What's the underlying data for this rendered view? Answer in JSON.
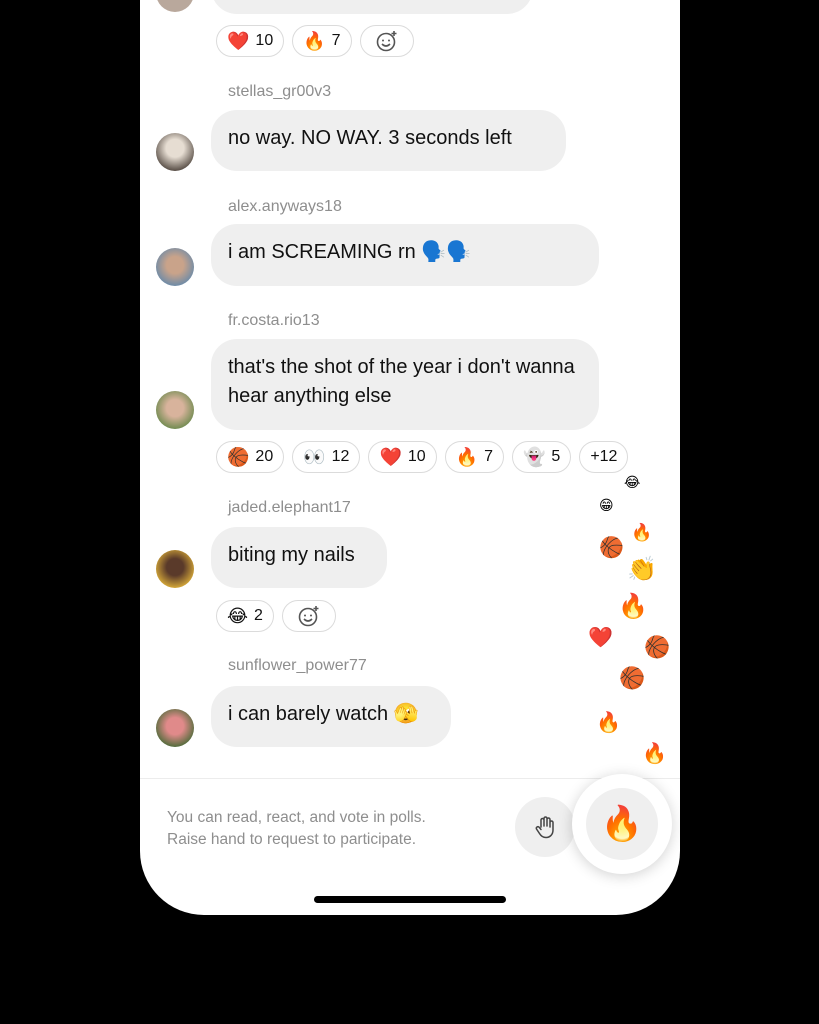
{
  "top_reactions": [
    {
      "emoji": "❤️",
      "count": "10"
    },
    {
      "emoji": "🔥",
      "count": "7"
    }
  ],
  "messages": [
    {
      "username": "stellas_gr00v3",
      "text": "no way. NO WAY. 3 seconds left"
    },
    {
      "username": "alex.anyways18",
      "text": "i am SCREAMING rn 🗣️🗣️"
    },
    {
      "username": "fr.costa.rio13",
      "text": "that's the shot of the year i don't wanna hear anything else",
      "reactions": [
        {
          "emoji": "🏀",
          "count": "20"
        },
        {
          "emoji": "👀",
          "count": "12"
        },
        {
          "emoji": "❤️",
          "count": "10"
        },
        {
          "emoji": "🔥",
          "count": "7"
        },
        {
          "emoji": "👻",
          "count": "5"
        },
        {
          "more": "+12"
        }
      ]
    },
    {
      "username": "jaded.elephant17",
      "text": "biting my nails",
      "reactions": [
        {
          "emoji": "😂",
          "count": "2"
        }
      ]
    },
    {
      "username": "sunflower_power77",
      "text": "i can barely watch 🫣"
    }
  ],
  "footer": {
    "line1": "You can read, react, and vote in polls.",
    "line2": "Raise hand to request to participate.",
    "hand_icon": "raise-hand-icon",
    "react_emoji": "🔥"
  },
  "floating_reactions": [
    "😂",
    "😁",
    "🔥",
    "🏀",
    "👏",
    "🔥",
    "❤️",
    "🏀",
    "🏀",
    "🔥",
    "🔥"
  ],
  "colors": {
    "bubble": "#efefef",
    "username": "#8e8e8e",
    "background": "#000000"
  }
}
